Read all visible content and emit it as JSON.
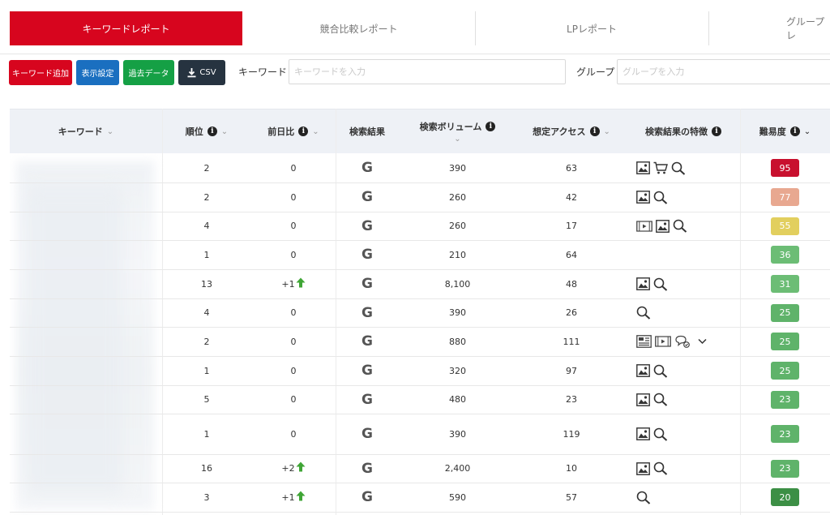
{
  "tabs": [
    {
      "label": "キーワードレポート",
      "active": true
    },
    {
      "label": "競合比較レポート",
      "active": false
    },
    {
      "label": "LPレポート",
      "active": false
    },
    {
      "label": "グループレ",
      "active": false
    }
  ],
  "toolbar": {
    "add_keyword": "キーワード追加",
    "display_settings": "表示設定",
    "past_data": "過去データ",
    "csv": "CSV",
    "keyword_label": "キーワード",
    "keyword_placeholder": "キーワードを入力",
    "keyword_value": "",
    "group_label": "グループ",
    "group_placeholder": "グループを入力",
    "group_value": ""
  },
  "table": {
    "headers": {
      "keyword": "キーワード",
      "rank": "順位",
      "change": "前日比",
      "serp": "検索結果",
      "volume": "検索ボリューム",
      "access": "想定アクセス",
      "features": "検索結果の特徴",
      "difficulty": "難易度"
    },
    "rows": [
      {
        "rank": "2",
        "change": "0",
        "up": false,
        "volume": "390",
        "access": "63",
        "features": [
          "image-icon",
          "cart-icon",
          "search-icon"
        ],
        "difficulty": "95",
        "color": "#c8102e"
      },
      {
        "rank": "2",
        "change": "0",
        "up": false,
        "volume": "260",
        "access": "42",
        "features": [
          "image-icon",
          "search-icon"
        ],
        "difficulty": "77",
        "color": "#e8a890"
      },
      {
        "rank": "4",
        "change": "0",
        "up": false,
        "volume": "260",
        "access": "17",
        "features": [
          "video-icon",
          "image-icon",
          "search-icon"
        ],
        "difficulty": "55",
        "color": "#e2cf5e"
      },
      {
        "rank": "1",
        "change": "0",
        "up": false,
        "volume": "210",
        "access": "64",
        "features": [],
        "difficulty": "36",
        "color": "#6cbd75"
      },
      {
        "rank": "13",
        "change": "+1",
        "up": true,
        "volume": "8,100",
        "access": "48",
        "features": [
          "image-icon",
          "search-icon"
        ],
        "difficulty": "31",
        "color": "#6cbd75"
      },
      {
        "rank": "4",
        "change": "0",
        "up": false,
        "volume": "390",
        "access": "26",
        "features": [
          "search-icon"
        ],
        "difficulty": "25",
        "color": "#5fb36a"
      },
      {
        "rank": "2",
        "change": "0",
        "up": false,
        "volume": "880",
        "access": "111",
        "features": [
          "news-icon",
          "video-icon",
          "review-icon",
          "chevron-down-icon"
        ],
        "difficulty": "25",
        "color": "#5fb36a"
      },
      {
        "rank": "1",
        "change": "0",
        "up": false,
        "volume": "320",
        "access": "97",
        "features": [
          "image-icon",
          "search-icon"
        ],
        "difficulty": "25",
        "color": "#5fb36a"
      },
      {
        "rank": "5",
        "change": "0",
        "up": false,
        "volume": "480",
        "access": "23",
        "features": [
          "image-icon",
          "search-icon"
        ],
        "difficulty": "23",
        "color": "#5fb36a"
      },
      {
        "rank": "1",
        "change": "0",
        "up": false,
        "volume": "390",
        "access": "119",
        "features": [
          "image-icon",
          "search-icon"
        ],
        "difficulty": "23",
        "color": "#5fb36a"
      },
      {
        "rank": "16",
        "change": "+2",
        "up": true,
        "volume": "2,400",
        "access": "10",
        "features": [
          "image-icon",
          "search-icon"
        ],
        "difficulty": "23",
        "color": "#5fb36a"
      },
      {
        "rank": "3",
        "change": "+1",
        "up": true,
        "volume": "590",
        "access": "57",
        "features": [
          "search-icon"
        ],
        "difficulty": "20",
        "color": "#3c8f45"
      }
    ]
  }
}
